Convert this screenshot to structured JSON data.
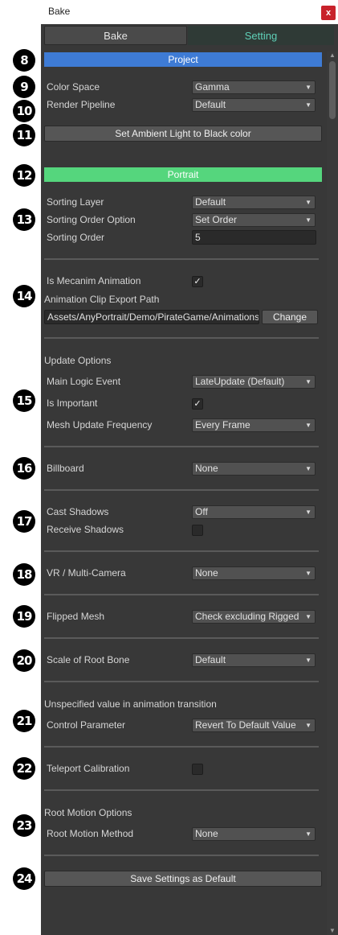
{
  "window": {
    "title": "Bake",
    "close_glyph": "x"
  },
  "tabs": [
    {
      "label": "Bake",
      "active": false
    },
    {
      "label": "Setting",
      "active": true
    }
  ],
  "markers": [
    "8",
    "9",
    "10",
    "11",
    "12",
    "13",
    "14",
    "15",
    "16",
    "17",
    "18",
    "19",
    "20",
    "21",
    "22",
    "23",
    "24"
  ],
  "project": {
    "header": "Project",
    "color_space": {
      "label": "Color Space",
      "value": "Gamma"
    },
    "render_pipeline": {
      "label": "Render Pipeline",
      "value": "Default"
    },
    "ambient_button": "Set Ambient Light to Black color"
  },
  "portrait": {
    "header": "Portrait",
    "sorting_layer": {
      "label": "Sorting Layer",
      "value": "Default"
    },
    "sorting_order_option": {
      "label": "Sorting Order Option",
      "value": "Set Order"
    },
    "sorting_order": {
      "label": "Sorting Order",
      "value": "5"
    }
  },
  "mecanim": {
    "label": "Is Mecanim Animation",
    "checked": true,
    "export_label": "Animation Clip Export Path",
    "export_path": "Assets/AnyPortrait/Demo/PirateGame/Animations",
    "change_button": "Change"
  },
  "update": {
    "title": "Update Options",
    "main_logic": {
      "label": "Main Logic Event",
      "value": "LateUpdate (Default)"
    },
    "is_important": {
      "label": "Is Important",
      "checked": true
    },
    "mesh_update": {
      "label": "Mesh Update Frequency",
      "value": "Every Frame"
    }
  },
  "billboard": {
    "label": "Billboard",
    "value": "None"
  },
  "shadows": {
    "cast": {
      "label": "Cast Shadows",
      "value": "Off"
    },
    "receive": {
      "label": "Receive Shadows",
      "checked": false
    }
  },
  "vr": {
    "label": "VR / Multi-Camera",
    "value": "None"
  },
  "flipped": {
    "label": "Flipped Mesh",
    "value": "Check excluding Rigged"
  },
  "root_scale": {
    "label": "Scale of Root Bone",
    "value": "Default"
  },
  "transition": {
    "title": "Unspecified value in animation transition",
    "control": {
      "label": "Control Parameter",
      "value": "Revert To Default Value"
    }
  },
  "teleport": {
    "label": "Teleport Calibration",
    "checked": false
  },
  "root_motion": {
    "title": "Root Motion Options",
    "method": {
      "label": "Root Motion Method",
      "value": "None"
    }
  },
  "save_button": "Save Settings as Default",
  "checkmark_glyph": "✓",
  "dropdown_arrow_glyph": "▼",
  "colors": {
    "project_header": "#3e7bd5",
    "portrait_header": "#55d67d",
    "setting_tab_text": "#5fd0b8",
    "close_button": "#c8222b"
  }
}
